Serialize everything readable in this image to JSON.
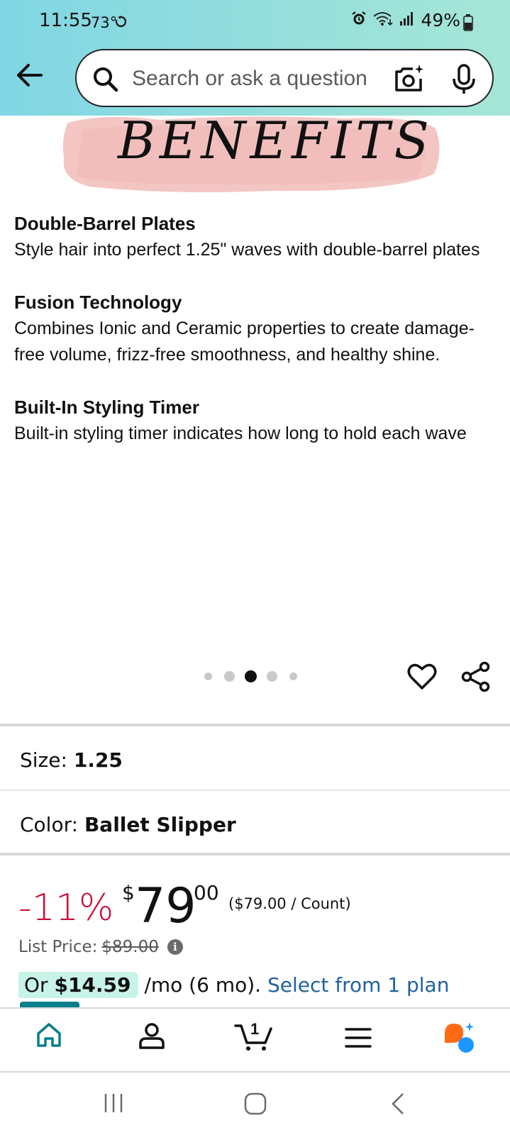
{
  "status_bar": {
    "time": "11:55",
    "temperature": "73°",
    "battery": "49%"
  },
  "search": {
    "placeholder": "Search or ask a question"
  },
  "banner": {
    "text": "BENEFITS"
  },
  "sections": [
    {
      "title": "Double-Barrel Plates",
      "body": "Style hair into perfect 1.25\" waves with double-barrel plates"
    },
    {
      "title": "Fusion Technology",
      "body": "Combines Ionic and Ceramic properties to create damage-free volume, frizz-free smoothness, and healthy shine."
    },
    {
      "title": "Built-In Styling Timer",
      "body": "Built-in styling timer indicates how long to hold each wave"
    }
  ],
  "carousel": {
    "total": 5,
    "active_index": 2
  },
  "size": {
    "label": "Size:",
    "value": "1.25"
  },
  "color": {
    "label": "Color:",
    "value": "Ballet Slipper"
  },
  "price": {
    "discount": "-11%",
    "currency": "$",
    "whole": "79",
    "cents": "00",
    "unit_price": "($79.00 / Count)",
    "list_price_label": "List Price:",
    "list_price_value": "$89.00",
    "info_icon": "i"
  },
  "plan": {
    "prefix": "Or",
    "monthly": "$14.59",
    "suffix": "/mo (6 mo).",
    "link": "Select from 1 plan"
  },
  "bottom_nav": {
    "cart_count": "1",
    "items": [
      "home-icon",
      "account-icon",
      "cart-icon",
      "menu-icon",
      "rufus-icon"
    ]
  },
  "colors": {
    "header_gradient_start": "#80d6e4",
    "header_gradient_end": "#a6e6d6",
    "discount": "#cc0c39",
    "link": "#2162a1",
    "plan_highlight": "#c8f3e8",
    "nav_active": "#087e8b"
  }
}
